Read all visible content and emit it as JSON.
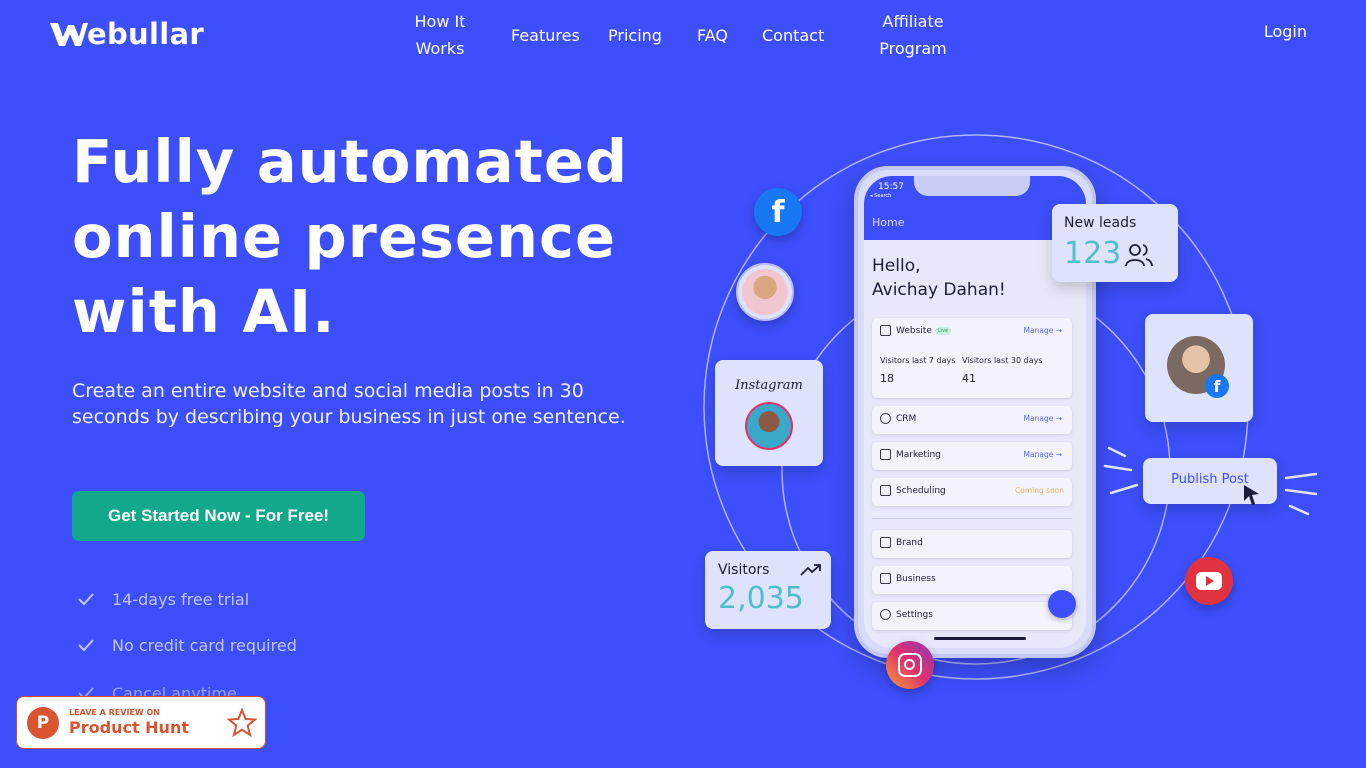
{
  "brand": {
    "name": "ebullar"
  },
  "nav": {
    "how_it_works_1": "How It",
    "how_it_works_2": "Works",
    "features": "Features",
    "pricing": "Pricing",
    "faq": "FAQ",
    "contact": "Contact",
    "affiliate_1": "Affiliate",
    "affiliate_2": "Program",
    "login": "Login"
  },
  "hero": {
    "title_1": "Fully automated",
    "title_2": "online presence",
    "title_3": "with AI.",
    "subtitle": "Create an entire website and social media posts in 30 seconds by describing your business in just one sentence.",
    "cta": "Get Started Now - For Free!",
    "perks": [
      "14-days free trial",
      "No credit card required",
      "Cancel anytime"
    ]
  },
  "product_hunt": {
    "small": "LEAVE A REVIEW ON",
    "big": "Product Hunt",
    "logo_letter": "P"
  },
  "illustration": {
    "new_leads_label": "New leads",
    "new_leads_value": "123",
    "visitors_label": "Visitors",
    "visitors_value": "2,035",
    "instagram_label": "Instagram",
    "publish_post": "Publish Post",
    "phone": {
      "time": "15:57",
      "search": "◂ Search",
      "home": "Home",
      "hello_1": "Hello,",
      "hello_2": "Avichay Dahan!",
      "website": "Website",
      "live": "Live",
      "manage": "Manage →",
      "visitors_7_label": "Visitors last 7 days",
      "visitors_7": "18",
      "visitors_30_label": "Visitors last 30 days",
      "visitors_30": "41",
      "crm": "CRM",
      "marketing": "Marketing",
      "scheduling": "Scheduling",
      "coming_soon": "Coming soon",
      "brand": "Brand",
      "business": "Business",
      "settings": "Settings"
    }
  },
  "colors": {
    "background": "#3d4ffc",
    "cta": "#12a88a",
    "accent_teal": "#4fc0c8"
  }
}
